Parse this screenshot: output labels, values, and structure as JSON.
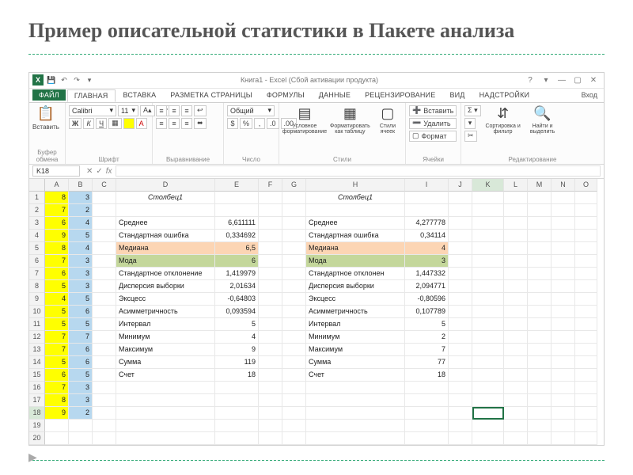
{
  "slide": {
    "title": "Пример описательной статистики в Пакете анализа"
  },
  "titlebar": {
    "app": "X",
    "title": "Книга1 - Excel (Сбой активации продукта)",
    "help": "?",
    "min": "—",
    "max": "▢",
    "close": "✕",
    "ribbon_opts": "▾"
  },
  "tabs": {
    "file": "ФАЙЛ",
    "items": [
      "ГЛАВНАЯ",
      "ВСТАВКА",
      "РАЗМЕТКА СТРАНИЦЫ",
      "ФОРМУЛЫ",
      "ДАННЫЕ",
      "РЕЦЕНЗИРОВАНИЕ",
      "ВИД",
      "НАДСТРОЙКИ"
    ],
    "active_index": 0,
    "signin": "Вход"
  },
  "ribbon": {
    "clipboard": {
      "paste": "Вставить",
      "label": "Буфер обмена"
    },
    "font": {
      "name": "Calibri",
      "size": "11",
      "label": "Шрифт",
      "bold": "Ж",
      "italic": "К",
      "underline": "Ч"
    },
    "align": {
      "label": "Выравнивание"
    },
    "number": {
      "format": "Общий",
      "label": "Число"
    },
    "styles": {
      "cond": "Условное форматирование",
      "astable": "Форматировать как таблицу",
      "cellstyles": "Стили ячеек",
      "label": "Стили"
    },
    "cells": {
      "insert": "Вставить",
      "delete": "Удалить",
      "format": "Формат",
      "label": "Ячейки"
    },
    "editing": {
      "sort": "Сортировка и фильтр",
      "find": "Найти и выделить",
      "label": "Редактирование"
    }
  },
  "formula_bar": {
    "name_box": "K18",
    "fx": "fx"
  },
  "columns": [
    "A",
    "B",
    "C",
    "D",
    "E",
    "F",
    "G",
    "H",
    "I",
    "J",
    "K",
    "L",
    "M",
    "N",
    "O"
  ],
  "col_classes": [
    "cA",
    "cB",
    "cC",
    "cD",
    "cE",
    "cF",
    "cG",
    "cH",
    "cI",
    "cJ",
    "cK",
    "cL",
    "cM",
    "cN",
    "cO"
  ],
  "row_count": 20,
  "selected": {
    "row": 18,
    "col": "K"
  },
  "colA": [
    "8",
    "7",
    "6",
    "9",
    "8",
    "7",
    "6",
    "5",
    "4",
    "5",
    "5",
    "7",
    "7",
    "5",
    "6",
    "7",
    "8",
    "9"
  ],
  "colB": [
    "3",
    "2",
    "4",
    "5",
    "4",
    "3",
    "3",
    "3",
    "5",
    "6",
    "5",
    "7",
    "6",
    "6",
    "5",
    "3",
    "3",
    "2"
  ],
  "stats": {
    "header": "Столбец1",
    "rows": [
      {
        "label": "Среднее",
        "v1": "6,611111",
        "v2": "4,277778"
      },
      {
        "label": "Стандартная ошибка",
        "v1": "0,334692",
        "v2": "0,34114"
      },
      {
        "label": "Медиана",
        "v1": "6,5",
        "v2": "4",
        "hl": "peach"
      },
      {
        "label": "Мода",
        "v1": "6",
        "v2": "3",
        "hl": "green"
      },
      {
        "label": "Стандартное отклонение",
        "v1": "1,419979",
        "v2": "1,447332",
        "label2": "Стандартное отклонен"
      },
      {
        "label": "Дисперсия выборки",
        "v1": "2,01634",
        "v2": "2,094771"
      },
      {
        "label": "Эксцесс",
        "v1": "-0,64803",
        "v2": "-0,80596"
      },
      {
        "label": "Асимметричность",
        "v1": "0,093594",
        "v2": "0,107789"
      },
      {
        "label": "Интервал",
        "v1": "5",
        "v2": "5"
      },
      {
        "label": "Минимум",
        "v1": "4",
        "v2": "2"
      },
      {
        "label": "Максимум",
        "v1": "9",
        "v2": "7"
      },
      {
        "label": "Сумма",
        "v1": "119",
        "v2": "77"
      },
      {
        "label": "Счет",
        "v1": "18",
        "v2": "18"
      }
    ]
  }
}
